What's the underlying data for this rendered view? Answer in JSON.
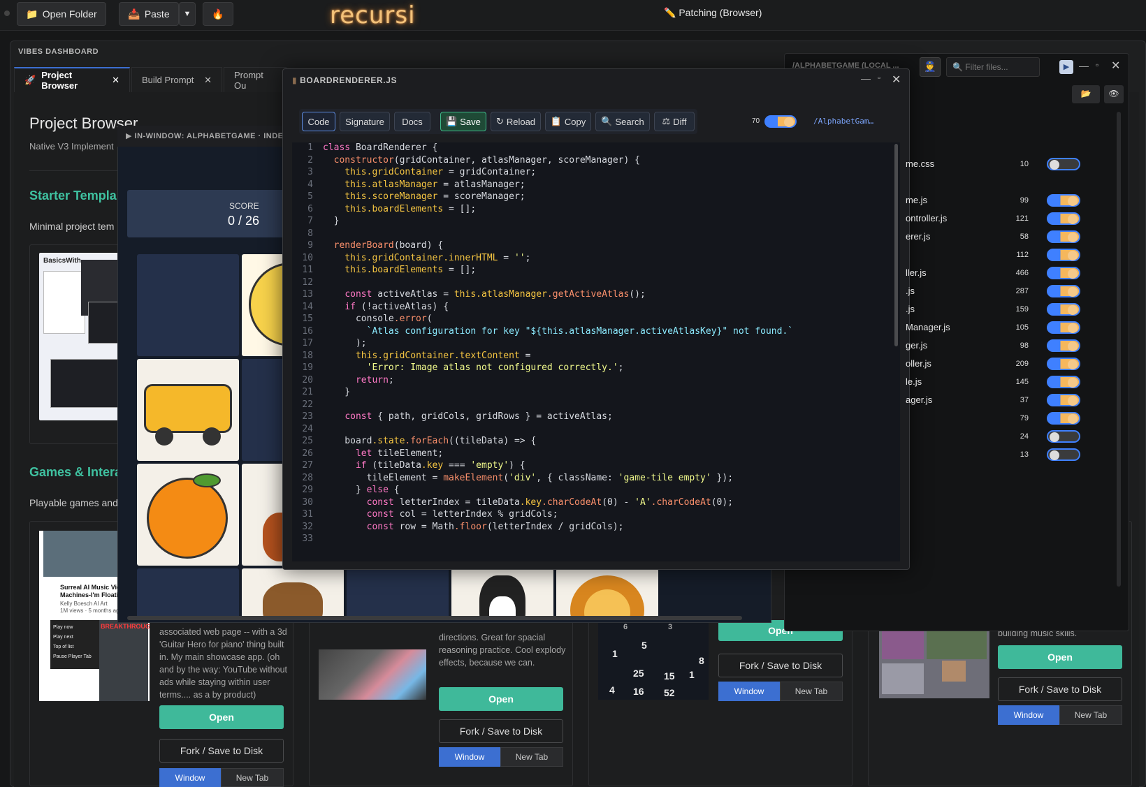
{
  "topbar": {
    "open_folder": "Open Folder",
    "paste": "Paste",
    "brand": "recursi",
    "status": "Patching (Browser)"
  },
  "dashboard": {
    "title": "VIBES DASHBOARD",
    "tabs": [
      {
        "label": "Project Browser"
      },
      {
        "label": "Build Prompt"
      },
      {
        "label": "Prompt Ou"
      }
    ],
    "heading": "Project Browser",
    "subtitle": "Native V3 Implement",
    "sections": [
      {
        "title": "Starter Templa",
        "desc": "Minimal project tem"
      },
      {
        "title": "Games & Intera",
        "desc": "Playable games and"
      }
    ],
    "cards": [
      {
        "desc": "associated web page -- with a 3d 'Guitar Hero for piano' thing built in. My main showcase app. (oh and by the way: YouTube without ads while staying within user terms.... as a by product)",
        "open": "Open",
        "fork": "Fork / Save to Disk",
        "window": "Window",
        "newtab": "New Tab"
      },
      {
        "desc": "directions. Great for spacial reasoning practice. Cool explody effects, because we can.",
        "open": "Open",
        "fork": "Fork / Save to Disk",
        "window": "Window",
        "newtab": "New Tab"
      },
      {
        "open": "Open",
        "fork": "Fork / Save to Disk",
        "window": "Window",
        "newtab": "New Tab"
      },
      {
        "desc": "building music skills.",
        "open": "Open",
        "fork": "Fork / Save to Disk",
        "window": "Window",
        "newtab": "New Tab"
      }
    ],
    "thumb_text": {
      "yt_title": "Surreal AI Music Vide Machines-I'm Floatin",
      "yt_channel": "Kelly Boesch AI Art",
      "yt_meta": "1M views · 5 months ag",
      "menu": [
        "Play now",
        "Play next",
        "Top of list",
        "Pause Player Tab"
      ],
      "breakthrough": "BREAKTHROUGH!",
      "basics": "BasicsWith"
    },
    "math_numbers": [
      "6",
      "3",
      "5",
      "8",
      "1",
      "25",
      "15",
      "1",
      "4",
      "16",
      "52"
    ]
  },
  "game": {
    "header": "▶ IN-WINDOW: ALPHABETGAME · INDE",
    "score_label": "SCORE",
    "score_value": "0 / 26"
  },
  "filepanel": {
    "title": "/ALPHABETGAME (LOCAL ...",
    "filter_placeholder": "Filter files...",
    "files": [
      {
        "name": "me.css",
        "count": "10",
        "on": false
      },
      {
        "name": "me.js",
        "count": "99",
        "on": true
      },
      {
        "name": "ontroller.js",
        "count": "121",
        "on": true
      },
      {
        "name": "erer.js",
        "count": "58",
        "on": true
      },
      {
        "name": "",
        "count": "112",
        "on": true
      },
      {
        "name": "ller.js",
        "count": "466",
        "on": true
      },
      {
        "name": ".js",
        "count": "287",
        "on": true
      },
      {
        "name": ".js",
        "count": "159",
        "on": true
      },
      {
        "name": "Manager.js",
        "count": "105",
        "on": true
      },
      {
        "name": "ger.js",
        "count": "98",
        "on": true
      },
      {
        "name": "oller.js",
        "count": "209",
        "on": true
      },
      {
        "name": "le.js",
        "count": "145",
        "on": true
      },
      {
        "name": "ager.js",
        "count": "37",
        "on": true
      },
      {
        "name": "",
        "count": "79",
        "on": true
      },
      {
        "name": "",
        "count": "24",
        "on": false
      },
      {
        "name": "",
        "count": "13",
        "on": false
      }
    ]
  },
  "editor": {
    "title": "BOARDRENDERER.JS",
    "tabs": [
      "Code",
      "Signature",
      "Docs"
    ],
    "actions": {
      "save": "Save",
      "reload": "Reload",
      "copy": "Copy",
      "search": "Search",
      "diff": "Diff"
    },
    "toggle_count": "70",
    "path": "/AlphabetGam…",
    "lines": [
      "class BoardRenderer {",
      "  constructor(gridContainer, atlasManager, scoreManager) {",
      "    this.gridContainer = gridContainer;",
      "    this.atlasManager = atlasManager;",
      "    this.scoreManager = scoreManager;",
      "    this.boardElements = [];",
      "  }",
      "",
      "  renderBoard(board) {",
      "    this.gridContainer.innerHTML = '';",
      "    this.boardElements = [];",
      "",
      "    const activeAtlas = this.atlasManager.getActiveAtlas();",
      "    if (!activeAtlas) {",
      "      console.error(",
      "        `Atlas configuration for key \"${this.atlasManager.activeAtlasKey}\" not found.`",
      "      );",
      "      this.gridContainer.textContent =",
      "        'Error: Image atlas not configured correctly.';",
      "      return;",
      "    }",
      "",
      "    const { path, gridCols, gridRows } = activeAtlas;",
      "",
      "    board.state.forEach((tileData) => {",
      "      let tileElement;",
      "      if (tileData.key === 'empty') {",
      "        tileElement = makeElement('div', { className: 'game-tile empty' });",
      "      } else {",
      "        const letterIndex = tileData.key.charCodeAt(0) - 'A'.charCodeAt(0);",
      "        const col = letterIndex % gridCols;",
      "        const row = Math.floor(letterIndex / gridCols);",
      ""
    ]
  }
}
